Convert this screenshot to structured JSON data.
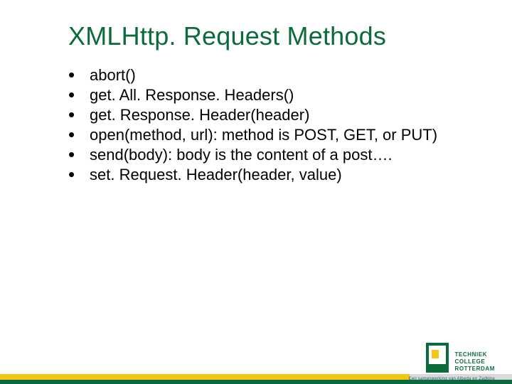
{
  "title": "XMLHttp. Request Methods",
  "bullets": [
    "abort()",
    "get. All. Response. Headers()",
    "get. Response. Header(header)",
    "open(method, url): method is POST, GET, or PUT)",
    "send(body): body is the content of a post….",
    "set. Request. Header(header, value)"
  ],
  "logo": {
    "line1": "TECHNIEK",
    "line2": "COLLEGE",
    "line3": "ROTTERDAM",
    "sub": "Een samenwerking van Albeda en Zadkine"
  }
}
